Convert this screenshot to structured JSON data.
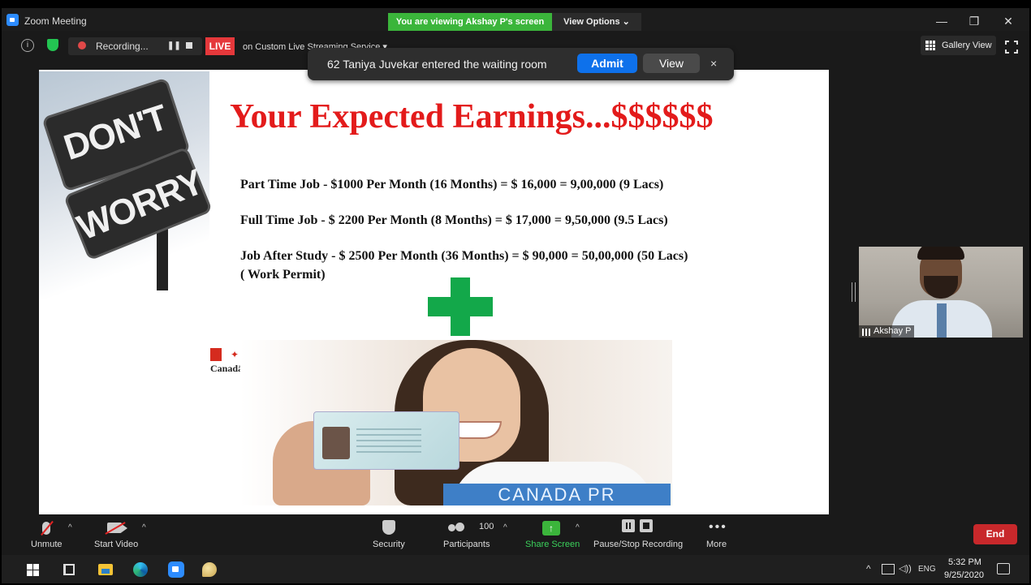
{
  "window": {
    "title": "Zoom Meeting",
    "viewing_banner": "You are viewing Akshay P's screen",
    "view_options": "View Options ⌄",
    "min": "—",
    "restore": "❐",
    "close": "✕"
  },
  "meeting_bar": {
    "info_glyph": "i",
    "recording_label": "Recording...",
    "pause_glyph": "❚❚",
    "live_badge": "LIVE",
    "stream_label": "on Custom Live Streaming Service ▾",
    "gallery_view": "Gallery View"
  },
  "waiting_room": {
    "message": "62 Taniya Juvekar entered the waiting room",
    "admit": "Admit",
    "view": "View",
    "close": "×"
  },
  "slide": {
    "sign_top": "DON'T",
    "sign_bottom": "WORRY",
    "title": "Your Expected Earnings...$$$$$$",
    "earnings": [
      "Part Time Job  - $1000 Per Month (16 Months)    =  $ 16,000 =  9,00,000 (9 Lacs)",
      "Full Time Job - $ 2200 Per Month (8 Months) = $ 17,000 = 9,50,000 (9.5 Lacs)",
      "Job After Study - $ 2500 Per Month (36 Months) = $ 90,000 = 50,00,000 (50 Lacs)",
      "( Work Permit)"
    ],
    "flag_leaf": "✦",
    "canada_wordmark": "Canadä",
    "band_text": "CANADA PR"
  },
  "participant": {
    "name": "Akshay P"
  },
  "toolbar": {
    "unmute": "Unmute",
    "start_video": "Start Video",
    "security": "Security",
    "participants": "Participants",
    "participants_count": "100",
    "share_screen": "Share Screen",
    "share_glyph": "↑",
    "pause_stop_recording": "Pause/Stop Recording",
    "more": "More",
    "more_glyph": "•••",
    "end": "End",
    "caret": "^"
  },
  "taskbar": {
    "tray_up": "^",
    "volume_glyph": "◁))",
    "language": "ENG",
    "time": "5:32 PM",
    "date": "9/25/2020"
  },
  "colors": {
    "live": "#e5383b",
    "viewing_banner": "#3bb53b",
    "admit": "#0e71eb",
    "end": "#c8282b",
    "slide_title": "#e31b1b",
    "plus": "#13a84a",
    "pr_band": "#3e7fc7"
  }
}
